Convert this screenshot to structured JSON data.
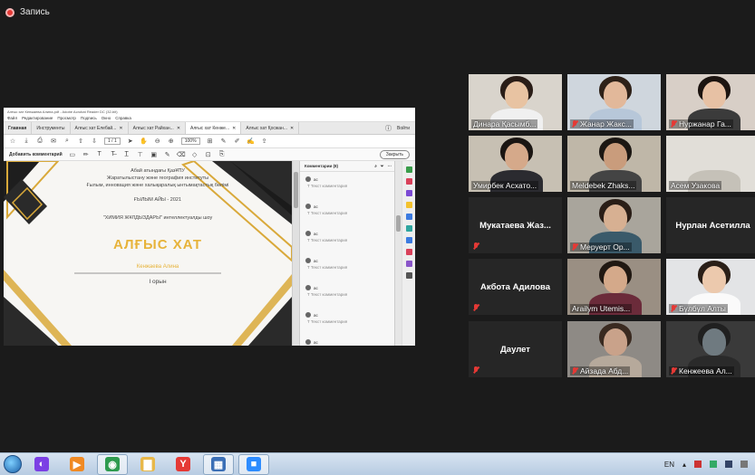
{
  "recording": {
    "label": "Запись",
    "color": "#e53935"
  },
  "shared_app": {
    "title": "Алғыс хат Кенжаева Алина.pdf - Adobe Acrobat Reader DC (32-bit)",
    "menu": [
      "Файл",
      "Редактирование",
      "Просмотр",
      "Подпись",
      "Окно",
      "Справка"
    ],
    "tabs": [
      {
        "label": "Главная"
      },
      {
        "label": "Инструменты"
      },
      {
        "label": "Алғыс хат Елебай..."
      },
      {
        "label": "Алғыс хат Райхан..."
      },
      {
        "label": "Алғыс хат Кенже..."
      },
      {
        "label": "Алғыс хат Қосжан..."
      }
    ],
    "login": "Войти",
    "page_indicator": "1 / 1",
    "zoom": "100%",
    "add_comment": "Добавить комментарий",
    "close": "Закрыть",
    "comments_header": "Комментарии (8)",
    "comment_placeholder": "Текст комментария",
    "comment_author": "ас",
    "comment_count": 7
  },
  "certificate": {
    "line1": "Абай атындағы ҚазҰПУ",
    "line2": "Жаратылыстану және география институты",
    "line3": "Ғылым, инновация және халықаралық ынтымақтастық бөлімі",
    "line4": "ҒЫЛЫМ АЙЫ - 2021",
    "line5": "\"ХИМИЯ ЖҰЛДЫЗДАРЫ\" интеллектуалды шоу",
    "heading": "АЛҒЫС ХАТ",
    "recipient": "Кенжаева Алина",
    "place": "І орын",
    "gold": "#e7b33a"
  },
  "participants": [
    {
      "name": "Динара Қасымб...",
      "video": true,
      "muted": false,
      "active": false
    },
    {
      "name": "Жанар Жакс...",
      "video": true,
      "muted": true,
      "active": false
    },
    {
      "name": "Нуржанар Га...",
      "video": true,
      "muted": true,
      "active": false
    },
    {
      "name": "Умирбек Асхато...",
      "video": true,
      "muted": false,
      "active": true
    },
    {
      "name": "Meldebek Zhaks...",
      "video": true,
      "muted": false,
      "active": false
    },
    {
      "name": "Асем Узакова",
      "video": true,
      "muted": false,
      "active": false
    },
    {
      "name": "Мукатаева Жаз...",
      "video": false,
      "muted": true,
      "active": false
    },
    {
      "name": "Меруерт Ор...",
      "video": true,
      "muted": true,
      "active": false
    },
    {
      "name": "Нурлан Асетилла",
      "video": false,
      "muted": false,
      "active": false
    },
    {
      "name": "Акбота Адилова",
      "video": false,
      "muted": true,
      "active": false
    },
    {
      "name": "Arailym Utemis...",
      "video": true,
      "muted": false,
      "active": false
    },
    {
      "name": "Бүлбүл Алты",
      "video": true,
      "muted": true,
      "active": false
    },
    {
      "name": "Даулет",
      "video": false,
      "muted": true,
      "active": false
    },
    {
      "name": "Айзада Абд...",
      "video": true,
      "muted": true,
      "active": false
    },
    {
      "name": "Кенжеева Ал...",
      "video": true,
      "muted": true,
      "active": false
    }
  ],
  "taskbar": {
    "apps": [
      {
        "icon": "alice-icon",
        "color": "#7b3fe4",
        "glyph": "◐"
      },
      {
        "icon": "media-player-icon",
        "color": "#f08a24",
        "glyph": "▶"
      },
      {
        "icon": "chrome-icon",
        "color": "#2e9b4f",
        "glyph": "◉"
      },
      {
        "icon": "folder-icon",
        "color": "#e8b84a",
        "glyph": "▇"
      },
      {
        "icon": "yandex-browser-icon",
        "color": "#e53935",
        "glyph": "Y"
      },
      {
        "icon": "presentation-icon",
        "color": "#3b6fb6",
        "glyph": "▦"
      },
      {
        "icon": "zoom-icon",
        "color": "#2d8cff",
        "glyph": "■"
      }
    ],
    "lang": "EN"
  }
}
